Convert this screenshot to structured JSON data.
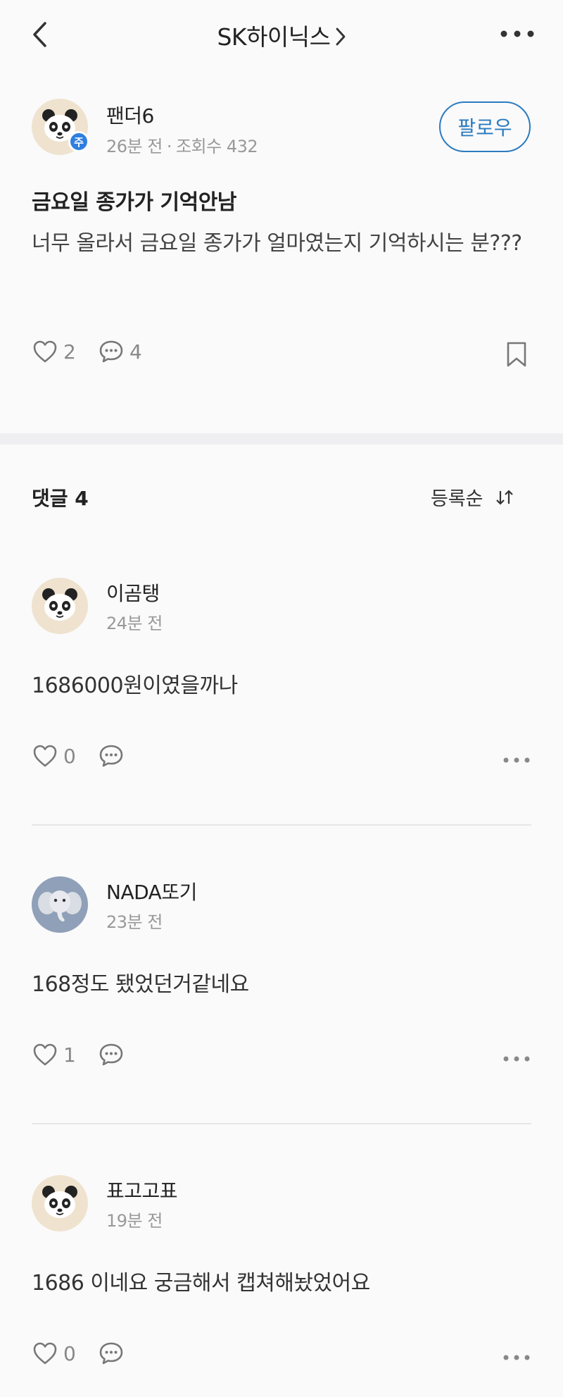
{
  "header": {
    "title": "SK하이닉스"
  },
  "post": {
    "author": "팬더6",
    "badge": "주",
    "time": "26분 전",
    "views": "조회수 432",
    "follow_label": "팔로우",
    "title": "금요일 종가가 기억안남",
    "body": "너무 올라서 금요일 종가가 얼마였는지 기억하시는 분???",
    "likes": "2",
    "comments": "4"
  },
  "comments_section": {
    "header": "댓글 4",
    "sort_label": "등록순",
    "items": [
      {
        "author": "이곰탱",
        "time": "24분 전",
        "text": "1686000원이였을까나",
        "likes": "0",
        "avatar": "panda"
      },
      {
        "author": "NADA또기",
        "time": "23분 전",
        "text": "168정도 됐었던거같네요",
        "likes": "1",
        "avatar": "elephant"
      },
      {
        "author": "표고고표",
        "time": "19분 전",
        "text": "1686 이네요 궁금해서 캡쳐해놨었어요",
        "likes": "0",
        "avatar": "panda"
      }
    ]
  },
  "icons": {
    "back": "chevron-left-icon",
    "more": "more-horizontal-icon",
    "like": "heart-icon",
    "comment": "comment-bubble-icon",
    "bookmark": "bookmark-icon",
    "sort": "sort-arrows-icon"
  },
  "colors": {
    "accent": "#2b7bbf",
    "badge": "#2f7fe0",
    "muted": "#999999"
  }
}
